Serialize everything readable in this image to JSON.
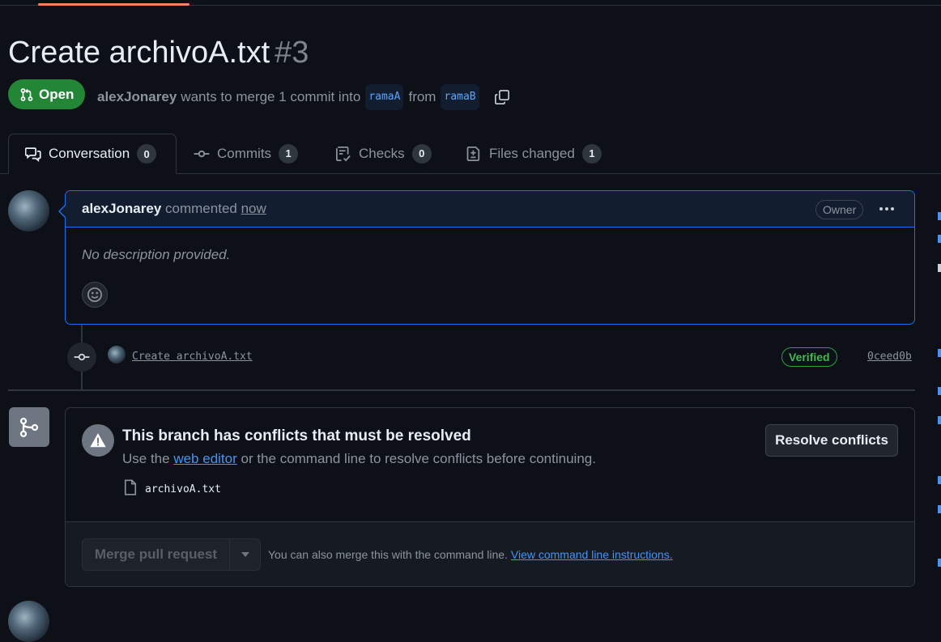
{
  "pr": {
    "title": "Create archivoA.txt",
    "number": "#3",
    "state": "Open",
    "author": "alexJonarey",
    "merge_text": "wants to merge 1 commit into",
    "base_branch": "ramaA",
    "from_text": "from",
    "head_branch": "ramaB"
  },
  "tabs": [
    {
      "label": "Conversation",
      "count": "0",
      "icon": "comment-discussion-icon",
      "active": true
    },
    {
      "label": "Commits",
      "count": "1",
      "icon": "git-commit-icon"
    },
    {
      "label": "Checks",
      "count": "0",
      "icon": "checklist-icon"
    },
    {
      "label": "Files changed",
      "count": "1",
      "icon": "file-diff-icon"
    }
  ],
  "comment": {
    "author": "alexJonarey",
    "action": "commented",
    "time": "now",
    "role": "Owner",
    "body": "No description provided."
  },
  "commit": {
    "message": "Create archivoA.txt",
    "status": "Verified",
    "sha": "0ceed0b"
  },
  "merge": {
    "conflict_title": "This branch has conflicts that must be resolved",
    "conflict_pre": "Use the",
    "conflict_link": "web editor",
    "conflict_post": "or the command line to resolve conflicts before continuing.",
    "conflict_file": "archivoA.txt",
    "resolve_label": "Resolve conflicts",
    "merge_button": "Merge pull request",
    "footer_text": "You can also merge this with the command line.",
    "footer_link": "View command line instructions."
  },
  "colors": {
    "background": "#0d1117",
    "open_green": "#238636",
    "accent_blue": "#1f6feb",
    "link_blue": "#4493f8",
    "verified_green": "#3fb950"
  }
}
